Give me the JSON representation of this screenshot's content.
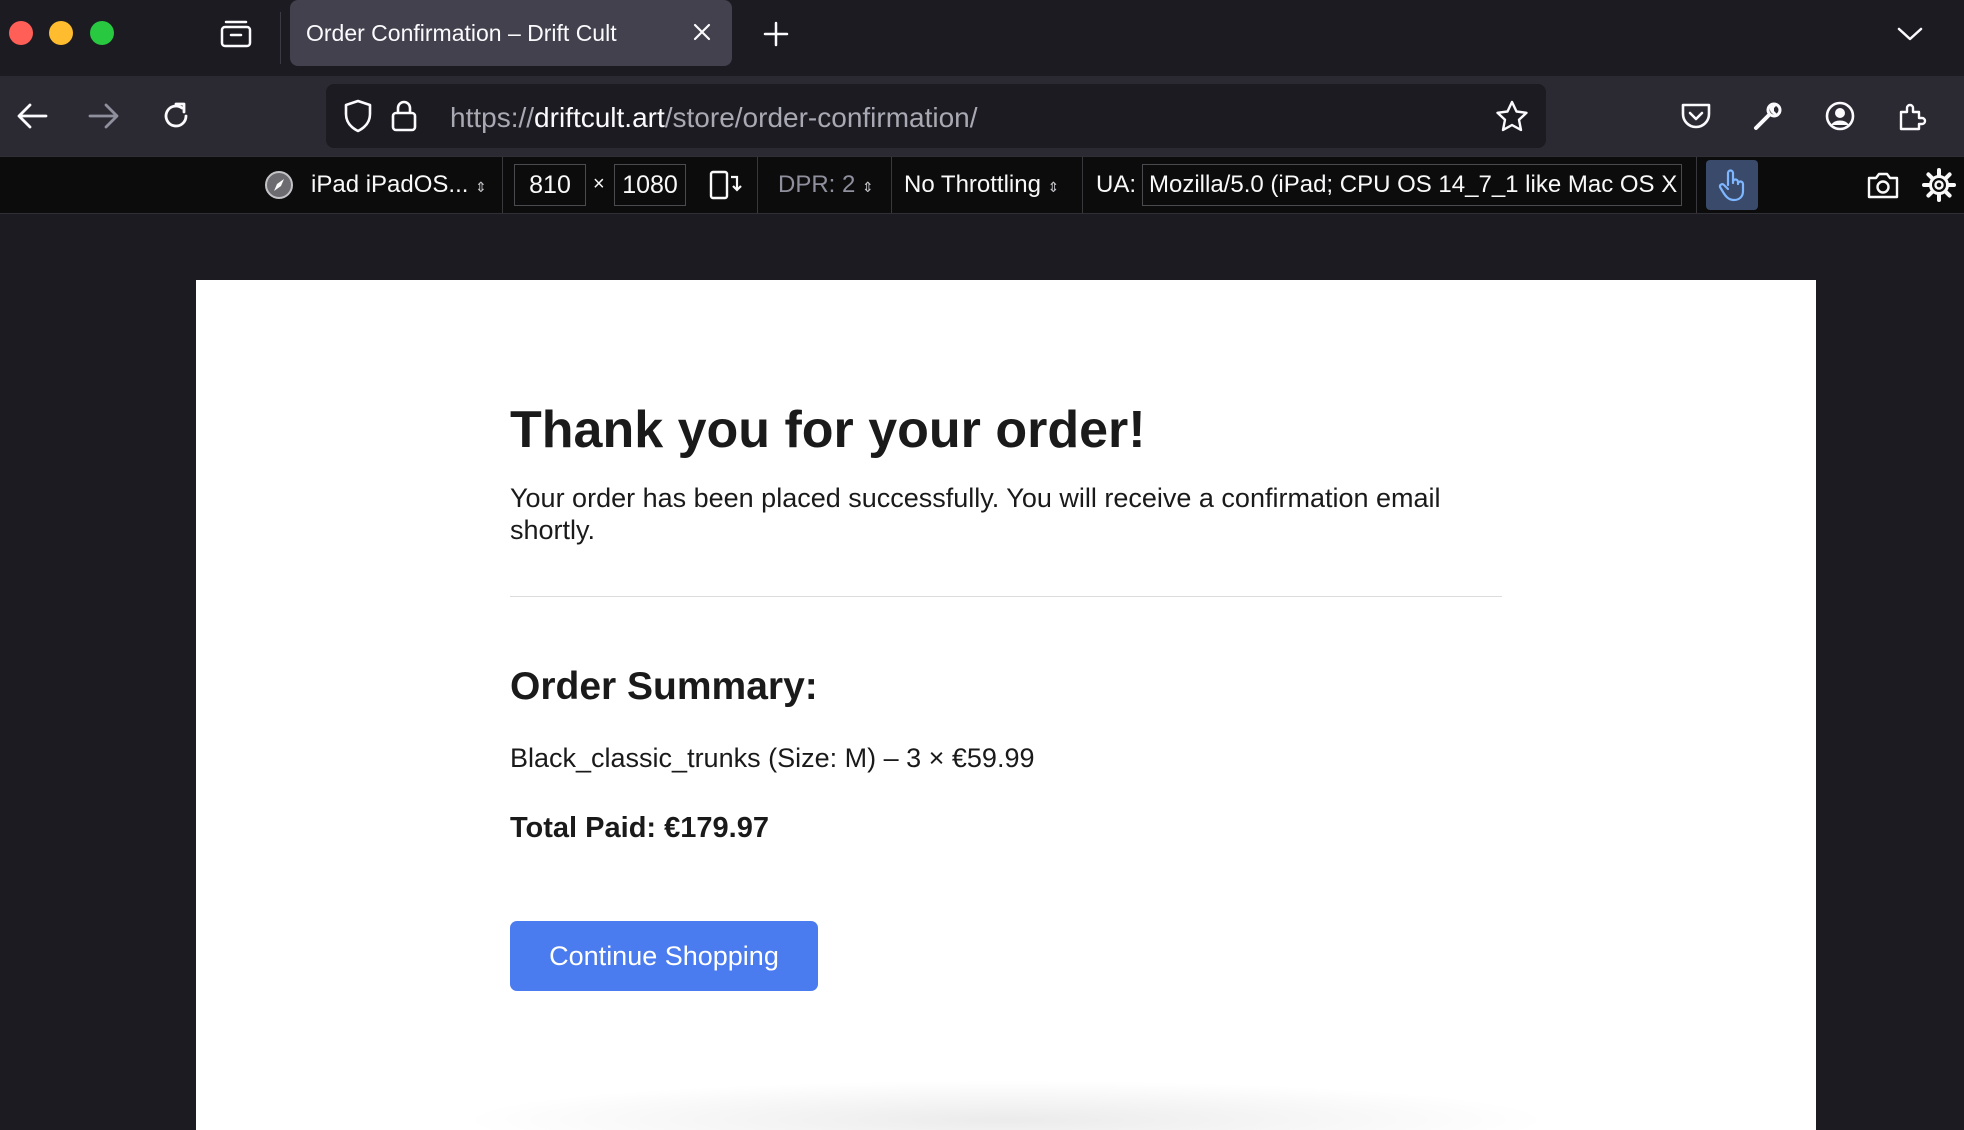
{
  "browser": {
    "tab": {
      "title": "Order Confirmation – Drift Cult"
    },
    "url": {
      "scheme": "https://",
      "host": "driftcult.art",
      "path": "/store/order-confirmation/"
    }
  },
  "rdm_toolbar": {
    "device": "iPad iPadOS...",
    "width": "810",
    "times": "×",
    "height": "1080",
    "dpr": "DPR: 2",
    "throttling": "No Throttling",
    "ua_label": "UA:",
    "ua_value": "Mozilla/5.0 (iPad; CPU OS 14_7_1 like Mac OS X"
  },
  "page": {
    "title": "Thank you for your order!",
    "intro": "Your order has been placed successfully. You will receive a confirmation email shortly.",
    "summary_title": "Order Summary:",
    "item_line": "Black_classic_trunks (Size: M) – 3 × €59.99",
    "total_line": "Total Paid: €179.97",
    "cta_label": "Continue Shopping"
  },
  "colors": {
    "accent_button": "#4a7cf0",
    "touch_active": "#3a4a6b"
  }
}
